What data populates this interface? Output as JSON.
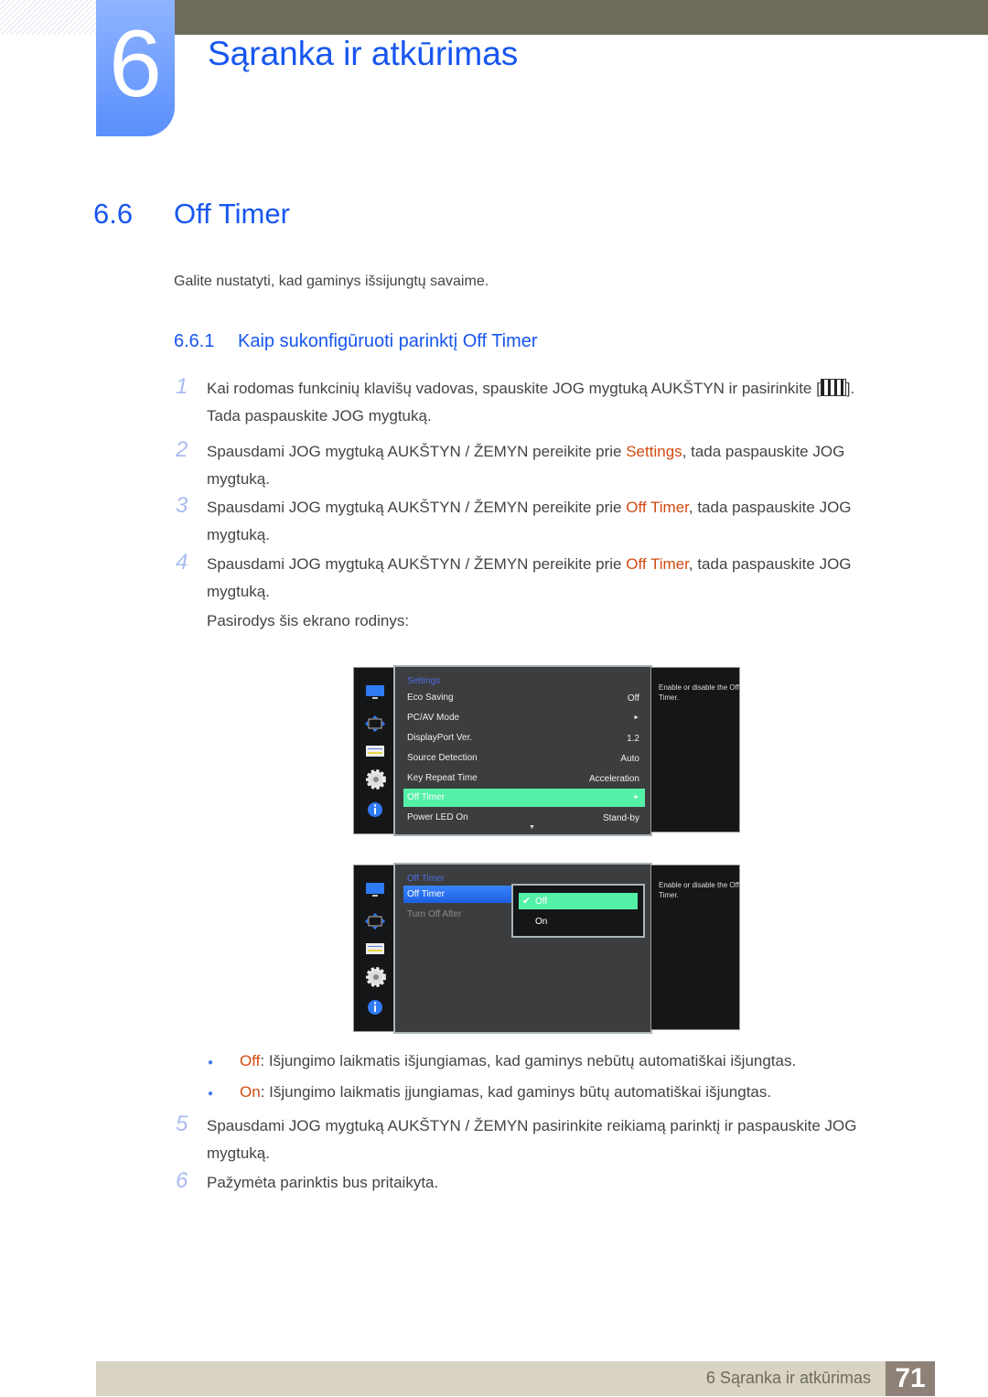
{
  "chapter": {
    "number": "6",
    "title": "Sąranka ir atkūrimas"
  },
  "section": {
    "number": "6.6",
    "title": "Off Timer",
    "intro": "Galite nustatyti, kad gaminys išsijungtų savaime."
  },
  "subsection": {
    "number": "6.6.1",
    "title": "Kaip sukonfigūruoti parinktį Off Timer"
  },
  "steps": [
    {
      "n": "1",
      "pre": "Kai rodomas funkcinių klavišų vadovas, spauskite JOG mygtuką AUKŠTYN ir pasirinkite [",
      "icon": "menu-grid-icon",
      "post": "].",
      "line2": "Tada paspauskite JOG mygtuką."
    },
    {
      "n": "2",
      "pre": "Spausdami JOG mygtuką AUKŠTYN / ŽEMYN pereikite prie ",
      "hl": "Settings",
      "post": ", tada paspauskite JOG",
      "line2": "mygtuką."
    },
    {
      "n": "3",
      "pre": "Spausdami JOG mygtuką AUKŠTYN / ŽEMYN pereikite prie ",
      "hl": "Off Timer",
      "post": ", tada paspauskite JOG",
      "line2": "mygtuką."
    },
    {
      "n": "4",
      "pre": "Spausdami JOG mygtuką AUKŠTYN / ŽEMYN pereikite prie ",
      "hl": "Off Timer",
      "post": ", tada paspauskite JOG",
      "line2": "mygtuką."
    },
    {
      "n": "5",
      "pre": "Spausdami JOG mygtuką AUKŠTYN / ŽEMYN pasirinkite reikiamą parinktį ir paspauskite JOG",
      "line2": "mygtuką."
    },
    {
      "n": "6",
      "pre": "Pažymėta parinktis bus pritaikyta."
    }
  ],
  "screen_note": "Pasirodys šis ekrano rodinys:",
  "osd1": {
    "title": "Settings",
    "rows": [
      {
        "label": "Eco Saving",
        "value": "Off"
      },
      {
        "label": "PC/AV Mode",
        "value": "►"
      },
      {
        "label": "DisplayPort Ver.",
        "value": "1.2"
      },
      {
        "label": "Source Detection",
        "value": "Auto"
      },
      {
        "label": "Key Repeat Time",
        "value": "Acceleration"
      },
      {
        "label": "Off Timer",
        "value": "►"
      },
      {
        "label": "Power LED On",
        "value": "Stand-by"
      }
    ],
    "selected_index": 5,
    "more": "▼",
    "help": "Enable or disable the Off Timer."
  },
  "osd2": {
    "title": "Off Timer",
    "rows": [
      {
        "label": "Off Timer"
      },
      {
        "label": "Turn Off After"
      }
    ],
    "options": [
      {
        "label": "Off",
        "check": "✔"
      },
      {
        "label": "On"
      }
    ],
    "help": "Enable or disable the Off Timer."
  },
  "bullets": [
    {
      "term": "Off",
      "text": ": Išjungimo laikmatis išjungiamas, kad gaminys nebūtų automatiškai išjungtas."
    },
    {
      "term": "On",
      "text": ": Išjungimo laikmatis įjungiamas, kad gaminys būtų automatiškai išjungtas."
    }
  ],
  "footer": {
    "chapter": "6 Sąranka ir atkūrimas",
    "page": "71"
  }
}
